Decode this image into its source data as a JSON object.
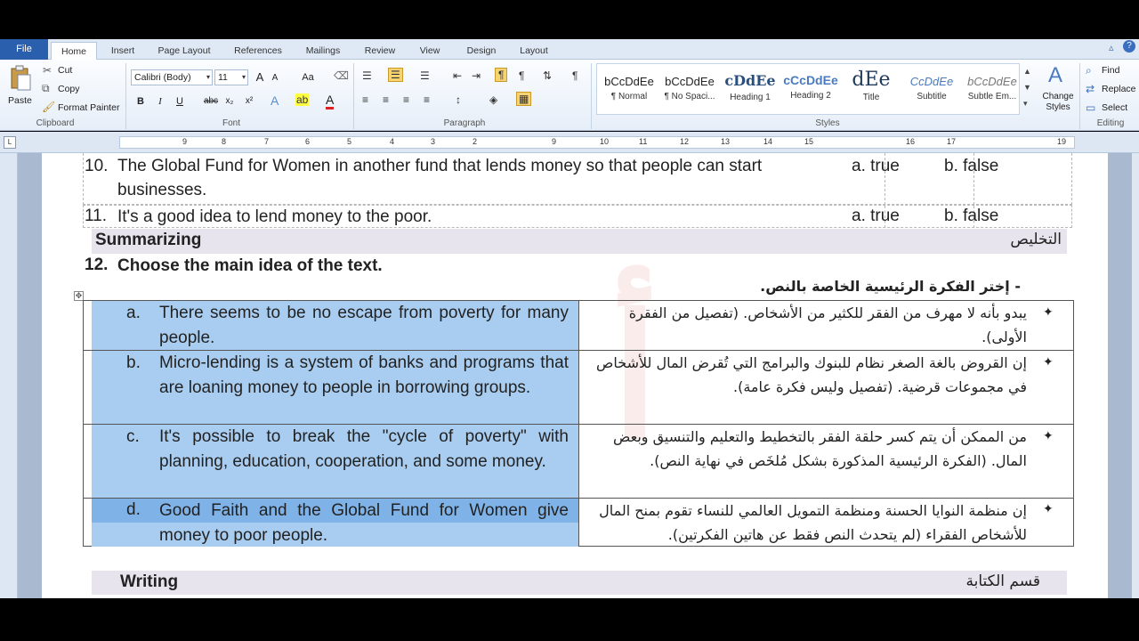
{
  "ribbon_tabs": {
    "file": "File",
    "home": "Home",
    "insert": "Insert",
    "page_layout": "Page Layout",
    "references": "References",
    "mailings": "Mailings",
    "review": "Review",
    "view": "View",
    "design": "Design",
    "layout": "Layout"
  },
  "clipboard": {
    "paste": "Paste",
    "cut": "Cut",
    "copy": "Copy",
    "format_painter": "Format Painter",
    "label": "Clipboard"
  },
  "font": {
    "name": "Calibri (Body)",
    "size": "11",
    "label": "Font",
    "bold": "B",
    "italic": "I",
    "underline": "U",
    "strike": "abc",
    "subscript": "x₂",
    "superscript": "x²",
    "grow": "A",
    "shrink": "A",
    "change_case": "Aa"
  },
  "paragraph": {
    "label": "Paragraph"
  },
  "styles": {
    "label": "Styles",
    "items": [
      {
        "sample": "bCcDdEe",
        "name": "¶ Normal"
      },
      {
        "sample": "bCcDdEe",
        "name": "¶ No Spaci..."
      },
      {
        "sample": "cDdEe",
        "name": "Heading 1"
      },
      {
        "sample": "cCcDdEe",
        "name": "Heading 2"
      },
      {
        "sample": "dEe",
        "name": "Title"
      },
      {
        "sample": "CcDdEe",
        "name": "Subtitle"
      },
      {
        "sample": "bCcDdEe",
        "name": "Subtle Em..."
      }
    ],
    "change_styles": "Change Styles"
  },
  "editing": {
    "find": "Find",
    "replace": "Replace",
    "select": "Select",
    "label": "Editing"
  },
  "ruler": {
    "left_marks": [
      "1",
      "2",
      "3",
      "4",
      "5",
      "6",
      "7",
      "8",
      "9"
    ],
    "right_marks": [
      "10",
      "11",
      "12",
      "13",
      "14",
      "15",
      "16",
      "17",
      "18",
      "19"
    ]
  },
  "document": {
    "questions": [
      {
        "num": "10.",
        "text": "The Global Fund for Women in another fund that lends money so that people can start businesses.",
        "opt_a": "a.   true",
        "opt_b": "b.   false"
      },
      {
        "num": "11.",
        "text": "It's a good idea to lend money to the poor.",
        "opt_a": "a.   true",
        "opt_b": "b.   false"
      }
    ],
    "summarizing": {
      "en": "Summarizing",
      "ar": "التخليص"
    },
    "q12": {
      "num": "12.",
      "text": "Choose the main idea of the text."
    },
    "arabic_instruction": "-    إختر الفكرة الرئيسية الخاصة بالنص.",
    "ideas": [
      {
        "letter": "a.",
        "en": "There seems to be no escape from poverty for many people.",
        "ar": "يبدو بأنه لا مهرف من الفقر للكثير من الأشخاص. (تفصيل من الفقرة الأولى)."
      },
      {
        "letter": "b.",
        "en": "Micro-lending is a system of banks and programs that are loaning money to people in borrowing groups.",
        "ar": "إن القروض بالغة الصغر نظام للبنوك والبرامج التي تُقرض المال للأشخاص في مجموعات قرضية. (تفصيل وليس فكرة عامة)."
      },
      {
        "letter": "c.",
        "en": "It's possible to break the \"cycle of poverty\" with planning, education, cooperation, and some money.",
        "ar": "من الممكن أن يتم كسر حلقة الفقر بالتخطيط والتعليم والتنسيق وبعض المال. (الفكرة الرئيسية المذكورة بشكل مُلخَص في نهاية النص)."
      },
      {
        "letter": "d.",
        "en": "Good Faith and the Global Fund for Women give money to poor people.",
        "ar": "إن منظمة النوايا الحسنة ومنظمة التمويل العالمي للنساء تقوم بمنح المال للأشخاص الفقراء (لم يتحدث النص فقط عن هاتين الفكرتين)."
      }
    ],
    "writing": {
      "en": "Writing",
      "ar": "قسم الكتابة"
    }
  }
}
